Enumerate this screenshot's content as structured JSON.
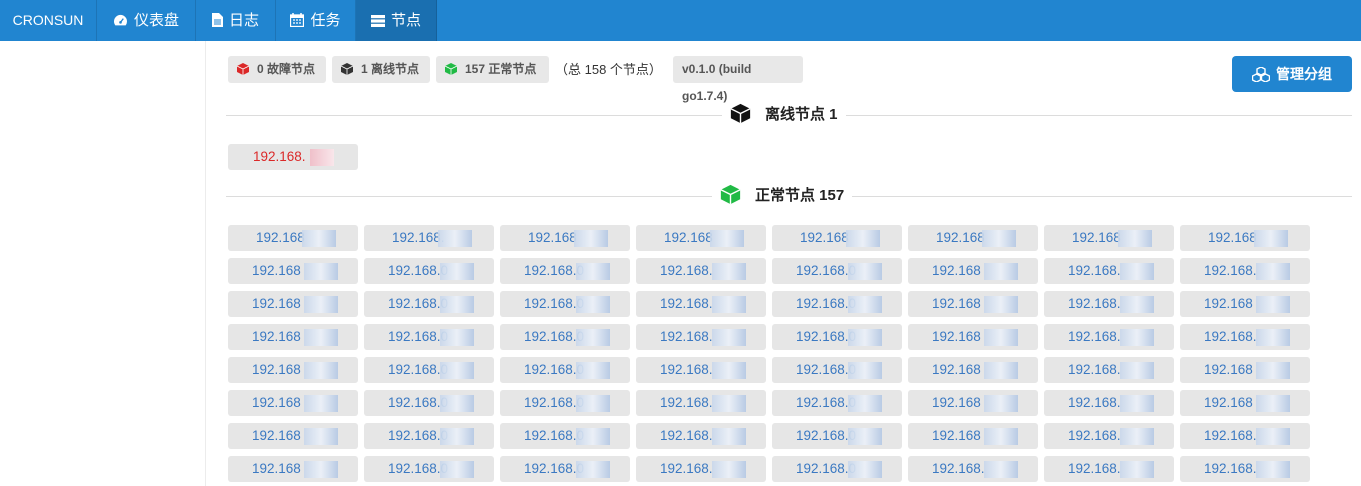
{
  "nav": {
    "brand": "CRONSUN",
    "items": [
      {
        "label": "仪表盘",
        "icon": "dashboard-icon",
        "active": false
      },
      {
        "label": "日志",
        "icon": "file-icon",
        "active": false
      },
      {
        "label": "任务",
        "icon": "calendar-icon",
        "active": false
      },
      {
        "label": "节点",
        "icon": "server-icon",
        "active": true
      }
    ]
  },
  "summary": {
    "fault_label": "0 故障节点",
    "offline_label": "1 离线节点",
    "normal_label": "157 正常节点",
    "total_text": "（总 158 个节点）",
    "version": "v0.1.0 (build go1.7.4)",
    "fault_color": "#db2828",
    "offline_color": "#333333",
    "normal_color": "#21ba45"
  },
  "manage_button": {
    "label": "管理分组",
    "icon": "cubes-icon"
  },
  "offline_section": {
    "title": "离线节点 1",
    "nodes": [
      "192.168."
    ]
  },
  "normal_section": {
    "title": "正常节点 157",
    "nodes": [
      "192.168",
      "192.168.",
      "192.168",
      "192.168",
      "192.168",
      "192.168",
      "192.168",
      "192.168",
      "192.168",
      "192.168.0",
      "192.168.0",
      "192.168.",
      "192.168.0",
      "192.168",
      "192.168.",
      "192.168.",
      "192.168",
      "192.168.0",
      "192.168.0",
      "192.168.",
      "192.168.0",
      "192.168",
      "192.168.",
      "192.168",
      "192.168",
      "192.168.0",
      "192.168.0",
      "192.168.",
      "192.168.0",
      "192.168",
      "192.168.",
      "192.168.",
      "192.168",
      "192.168.0",
      "192.168.0",
      "192.168.",
      "192.168.0",
      "192.168",
      "192.168.",
      "192.168",
      "192.168",
      "192.168.0",
      "192.168.0",
      "192.168.",
      "192.168.0",
      "192.168",
      "192.168.",
      "192.168",
      "192.168",
      "192.168.0",
      "192.168.0",
      "192.168.",
      "192.168.0",
      "192.168",
      "192.168.",
      "192.168.",
      "192.168",
      "192.168.0",
      "192.168.0",
      "192.168.",
      "192.168.0",
      "192.168.",
      "192.168.",
      "192.168."
    ]
  }
}
